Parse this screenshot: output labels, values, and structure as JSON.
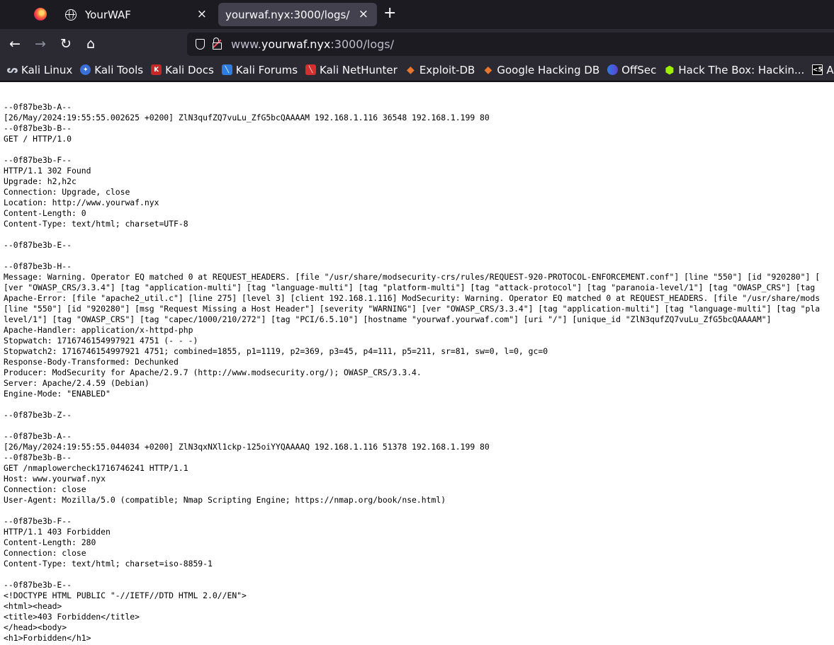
{
  "tabs": [
    {
      "title": "YourWAF",
      "icon": "globe-icon"
    },
    {
      "title": "yourwaf.nyx:3000/logs/",
      "icon": "none",
      "active": true
    }
  ],
  "tab_close_glyph": "×",
  "new_tab_glyph": "+",
  "nav": {
    "back_glyph": "←",
    "forward_glyph": "→",
    "reload_glyph": "↻",
    "home_glyph": "⌂"
  },
  "url": {
    "prefix": "www.",
    "host": "yourwaf.nyx",
    "rest": ":3000/logs/"
  },
  "bookmarks": [
    {
      "label": "Kali Linux",
      "icon": "kali-dragon-icon",
      "color": "#1d1d1d"
    },
    {
      "label": "Kali Tools",
      "icon": "kali-tools-icon",
      "color": "#3a6fd8"
    },
    {
      "label": "Kali Docs",
      "icon": "kali-docs-icon",
      "color": "#c62828"
    },
    {
      "label": "Kali Forums",
      "icon": "kali-forums-icon",
      "color": "#2f7de1"
    },
    {
      "label": "Kali NetHunter",
      "icon": "nethunter-icon",
      "color": "#d32f2f"
    },
    {
      "label": "Exploit-DB",
      "icon": "exploit-db-icon",
      "color": "#e8772e"
    },
    {
      "label": "Google Hacking DB",
      "icon": "ghdb-icon",
      "color": "#e8772e"
    },
    {
      "label": "OffSec",
      "icon": "offsec-icon",
      "color": "#5b3fd4"
    },
    {
      "label": "Hack The Box: Hackin...",
      "icon": "htb-icon",
      "color": "#9fef00"
    },
    {
      "label": "Apuntes y",
      "icon": "apuntes-icon",
      "color": "#000000"
    }
  ],
  "log_lines": [
    "--0f87be3b-A--",
    "[26/May/2024:19:55:55.002625 +0200] ZlN3qufZQ7vuLu_ZfG5bcQAAAAM 192.168.1.116 36548 192.168.1.199 80",
    "--0f87be3b-B--",
    "GET / HTTP/1.0",
    "",
    "--0f87be3b-F--",
    "HTTP/1.1 302 Found",
    "Upgrade: h2,h2c",
    "Connection: Upgrade, close",
    "Location: http://www.yourwaf.nyx",
    "Content-Length: 0",
    "Content-Type: text/html; charset=UTF-8",
    "",
    "--0f87be3b-E--",
    "",
    "--0f87be3b-H--",
    "Message: Warning. Operator EQ matched 0 at REQUEST_HEADERS. [file \"/usr/share/modsecurity-crs/rules/REQUEST-920-PROTOCOL-ENFORCEMENT.conf\"] [line \"550\"] [id \"920280\"] [",
    "[ver \"OWASP_CRS/3.3.4\"] [tag \"application-multi\"] [tag \"language-multi\"] [tag \"platform-multi\"] [tag \"attack-protocol\"] [tag \"paranoia-level/1\"] [tag \"OWASP_CRS\"] [tag",
    "Apache-Error: [file \"apache2_util.c\"] [line 275] [level 3] [client 192.168.1.116] ModSecurity: Warning. Operator EQ matched 0 at REQUEST_HEADERS. [file \"/usr/share/mods",
    "[line \"550\"] [id \"920280\"] [msg \"Request Missing a Host Header\"] [severity \"WARNING\"] [ver \"OWASP_CRS/3.3.4\"] [tag \"application-multi\"] [tag \"language-multi\"] [tag \"pla",
    "level/1\"] [tag \"OWASP_CRS\"] [tag \"capec/1000/210/272\"] [tag \"PCI/6.5.10\"] [hostname \"yourwaf.yourwaf.com\"] [uri \"/\"] [unique_id \"ZlN3qufZQ7vuLu_ZfG5bcQAAAAM\"]",
    "Apache-Handler: application/x-httpd-php",
    "Stopwatch: 1716746154997921 4751 (- - -)",
    "Stopwatch2: 1716746154997921 4751; combined=1855, p1=1119, p2=369, p3=45, p4=111, p5=211, sr=81, sw=0, l=0, gc=0",
    "Response-Body-Transformed: Dechunked",
    "Producer: ModSecurity for Apache/2.9.7 (http://www.modsecurity.org/); OWASP_CRS/3.3.4.",
    "Server: Apache/2.4.59 (Debian)",
    "Engine-Mode: \"ENABLED\"",
    "",
    "--0f87be3b-Z--",
    "",
    "--0f87be3b-A--",
    "[26/May/2024:19:55:55.044034 +0200] ZlN3qxNXl1ckp-125oiYYQAAAAQ 192.168.1.116 51378 192.168.1.199 80",
    "--0f87be3b-B--",
    "GET /nmaplowercheck1716746241 HTTP/1.1",
    "Host: www.yourwaf.nyx",
    "Connection: close",
    "User-Agent: Mozilla/5.0 (compatible; Nmap Scripting Engine; https://nmap.org/book/nse.html)",
    "",
    "--0f87be3b-F--",
    "HTTP/1.1 403 Forbidden",
    "Content-Length: 280",
    "Connection: close",
    "Content-Type: text/html; charset=iso-8859-1",
    "",
    "--0f87be3b-E--",
    "<!DOCTYPE HTML PUBLIC \"-//IETF//DTD HTML 2.0//EN\">",
    "<html><head>",
    "<title>403 Forbidden</title>",
    "</head><body>",
    "<h1>Forbidden</h1>"
  ]
}
